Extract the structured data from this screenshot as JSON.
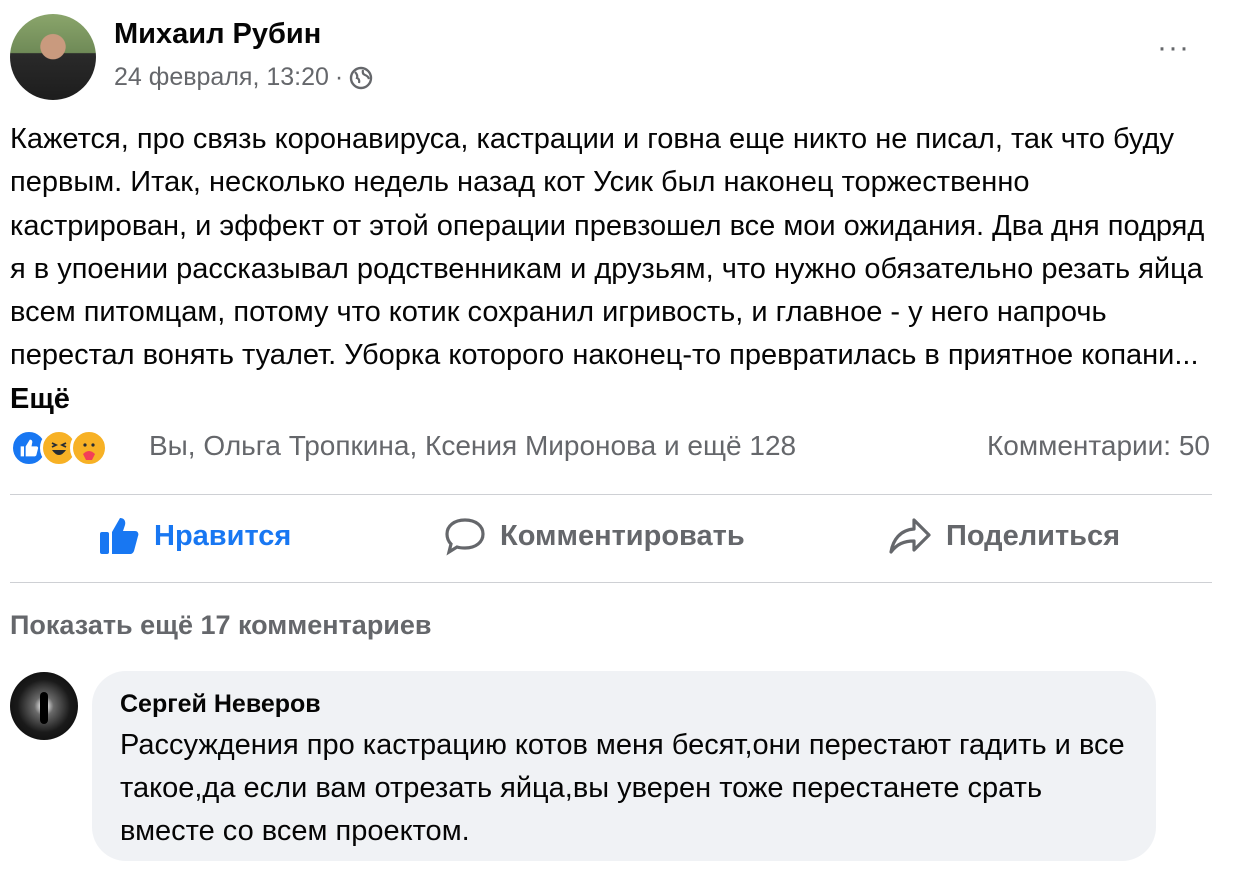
{
  "post": {
    "author": "Михаил Рубин",
    "date": "24 февраля, 13:20",
    "separator": "·",
    "privacy_icon": "globe-icon",
    "more_icon": "···",
    "text": "Кажется, про связь коронавируса, кастрации и говна еще никто не писал, так что буду первым. Итак, несколько недель назад кот Усик был наконец торжественно кастрирован, и эффект от этой операции превзошел все мои ожидания. Два дня подряд я в упоении рассказывал родственникам и друзьям, что нужно обязательно резать яйца всем питомцам, потому что котик сохранил игривость, и главное - у него напрочь перестал вонять туалет. Уборка которого наконец-то превратилась в приятное копани...",
    "see_more": "Ещё"
  },
  "reactions": {
    "icons": [
      "like-icon",
      "haha-icon",
      "care-icon"
    ],
    "names": "Вы, Ольга Тропкина, Ксения Миронова и ещё 128",
    "comments": "Комментарии: 50"
  },
  "actions": {
    "like": "Нравится",
    "comment": "Комментировать",
    "share": "Поделиться"
  },
  "colors": {
    "accent": "#1877f2",
    "secondary_text": "#65676b",
    "bubble_bg": "#f0f2f5"
  },
  "show_more_comments": "Показать ещё 17 комментариев",
  "comment": {
    "author": "Сергей Неверов",
    "text": "Рассуждения про кастрацию котов меня бесят,они перестают гадить и все такое,да если вам отрезать яйца,вы уверен тоже перестанете срать вместе со всем проектом."
  }
}
